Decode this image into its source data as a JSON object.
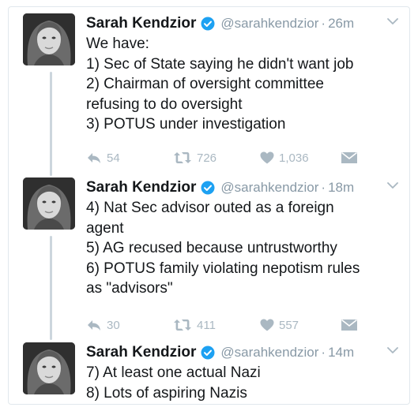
{
  "tweets": [
    {
      "author": "Sarah Kendzior",
      "handle": "@sarahkendzior",
      "separator": "·",
      "time": "26m",
      "lines": [
        "We have:",
        "1) Sec of State saying he didn't want job",
        "2) Chairman of oversight committee",
        "refusing to do oversight",
        "3) POTUS under investigation"
      ],
      "replies": "54",
      "retweets": "726",
      "likes": "1,036"
    },
    {
      "author": "Sarah Kendzior",
      "handle": "@sarahkendzior",
      "separator": "·",
      "time": "18m",
      "lines": [
        "4) Nat Sec advisor outed as a foreign",
        "agent",
        "5) AG recused because untrustworthy",
        "6) POTUS family violating nepotism rules",
        "as \"advisors\""
      ],
      "replies": "30",
      "retweets": "411",
      "likes": "557"
    },
    {
      "author": "Sarah Kendzior",
      "handle": "@sarahkendzior",
      "separator": "·",
      "time": "14m",
      "lines": [
        "7) At least one actual Nazi",
        "8) Lots of aspiring Nazis"
      ]
    }
  ],
  "icons": {
    "verified": "verified-badge-icon",
    "caret": "chevron-down-icon",
    "reply": "reply-icon",
    "retweet": "retweet-icon",
    "like": "heart-icon",
    "dm": "direct-message-icon"
  },
  "colors": {
    "verified": "#1da1f2",
    "muted": "#8899a6",
    "action": "#aab8c2",
    "thread": "#ccd6dd"
  }
}
